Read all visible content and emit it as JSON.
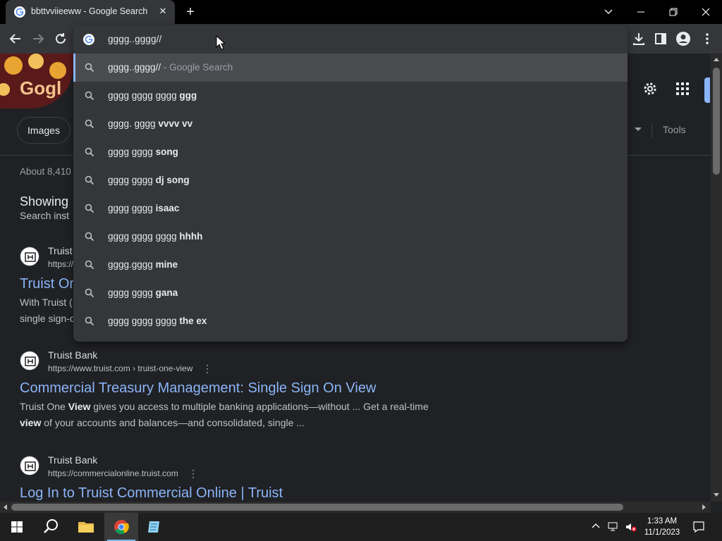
{
  "browser": {
    "tab": {
      "title": "bbttvviieeww - Google Search",
      "favicon": "google-g-icon"
    },
    "omnibox": {
      "input_value": "gggg..gggg//",
      "suggestions": [
        {
          "plain": "gggg..gggg//",
          "bold": "",
          "hint": " - Google Search",
          "selected": true
        },
        {
          "plain": "gggg gggg gggg ",
          "bold": "ggg",
          "hint": ""
        },
        {
          "plain": "gggg. gggg ",
          "bold": "vvvv vv",
          "hint": ""
        },
        {
          "plain": "gggg gggg ",
          "bold": "song",
          "hint": ""
        },
        {
          "plain": "gggg gggg ",
          "bold": "dj song",
          "hint": ""
        },
        {
          "plain": "gggg gggg ",
          "bold": "isaac",
          "hint": ""
        },
        {
          "plain": "gggg gggg gggg ",
          "bold": "hhhh",
          "hint": ""
        },
        {
          "plain": "gggg.gggg ",
          "bold": "mine",
          "hint": ""
        },
        {
          "plain": "gggg gggg ",
          "bold": "gana",
          "hint": ""
        },
        {
          "plain": "gggg gggg gggg ",
          "bold": "the ex",
          "hint": ""
        }
      ]
    }
  },
  "page": {
    "doodle_text": "Gogl",
    "chip_images": "Images",
    "tools": "Tools",
    "result_stats": "About 8,410",
    "showing": "Showing",
    "search_instead": "Search inst",
    "results": [
      {
        "site": "Truist",
        "url": "https://",
        "title": "Truist Or",
        "snippet_lines": [
          "With Truist (",
          "single sign-o"
        ]
      },
      {
        "site": "Truist Bank",
        "url": "https://www.truist.com › truist-one-view",
        "title": "Commercial Treasury Management: Single Sign On View",
        "snippet_1_pre": "Truist One ",
        "snippet_1_bold": "View",
        "snippet_1_post": " gives you access to multiple banking applications—without ... Get a real-time",
        "snippet_2_bold": "view",
        "snippet_2_post": " of your accounts and balances—and consolidated, single ..."
      },
      {
        "site": "Truist Bank",
        "url": "https://commercialonline.truist.com",
        "title": "Log In to Truist Commercial Online | Truist"
      }
    ]
  },
  "taskbar": {
    "time": "1:33 AM",
    "date": "11/1/2023"
  },
  "colors": {
    "accent_blue": "#8ab4f8",
    "background": "#202124",
    "popup": "#35363a"
  }
}
